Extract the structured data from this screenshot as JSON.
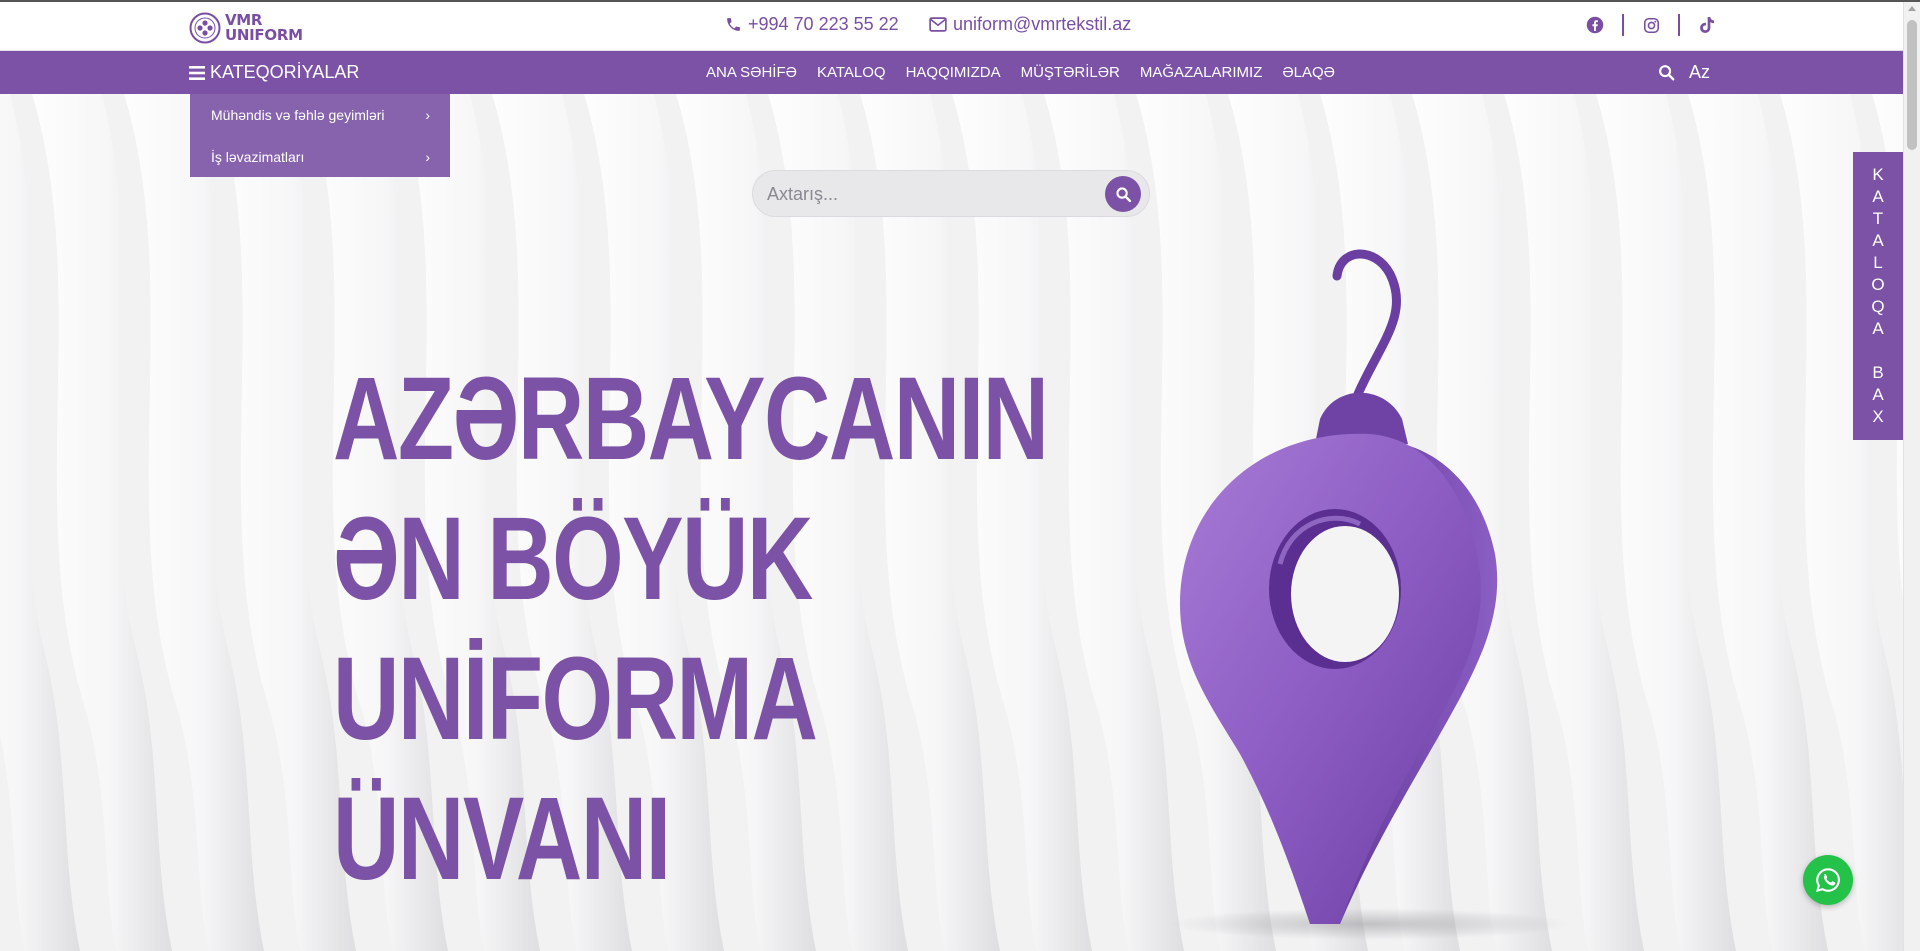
{
  "brand": {
    "line1": "VMR",
    "line2": "UNIFORM"
  },
  "contact": {
    "phone": "+994 70 223 55 22",
    "email": "uniform@vmrtekstil.az"
  },
  "socials": [
    {
      "name": "facebook-icon"
    },
    {
      "name": "instagram-icon"
    },
    {
      "name": "tiktok-icon"
    }
  ],
  "nav": {
    "categories_label": "KATEQORİYALAR",
    "links": [
      "ANA SƏHİFƏ",
      "KATALOQ",
      "HAQQIMIZDA",
      "MÜŞTƏRİLƏR",
      "MAĞAZALARIMIZ",
      "ƏLAQƏ"
    ],
    "language": "Az"
  },
  "dropdown": {
    "items": [
      "Mühəndis və fəhlə geyimləri",
      "İş ləvazimatları"
    ],
    "chevron": "›"
  },
  "search": {
    "placeholder": "Axtarış..."
  },
  "hero": {
    "headline": [
      "AZƏRBAYCANIN",
      "ƏN BÖYÜK",
      "UNİFORMA",
      "ÜNVANI"
    ]
  },
  "side_tab": {
    "letters": [
      "K",
      "A",
      "T",
      "A",
      "L",
      "O",
      "Q",
      "A",
      "",
      "B",
      "A",
      "X"
    ]
  },
  "colors": {
    "brand_purple": "#7b52a5",
    "dropdown_purple": "#8763ae",
    "whatsapp_green": "#25c24a"
  }
}
